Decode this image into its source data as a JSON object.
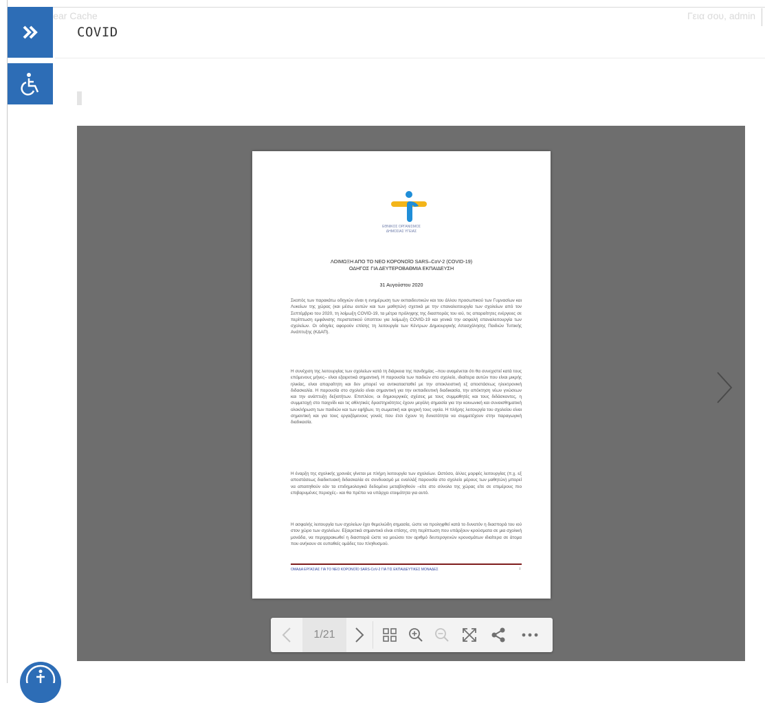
{
  "adminbar": {
    "clear_cache_label": "Clear Cache",
    "greeting": "Γεια σου, admin"
  },
  "sidebar": {
    "expand_icon": "double-chevron-right-icon",
    "accessibility_icon": "wheelchair-icon",
    "accent_color": "#2d6db6"
  },
  "page": {
    "title": "COVID"
  },
  "viewer": {
    "current_page": "1/21",
    "background_color": "#6e6e6e",
    "toolbar_icons": [
      "prev-page-icon",
      "next-page-icon",
      "grid-view-icon",
      "zoom-in-icon",
      "zoom-out-icon",
      "fullscreen-icon",
      "share-icon",
      "more-icon"
    ],
    "document": {
      "logo_text_line1": "ΕΘΝΙΚΟΣ ΟΡΓΑΝΙΣΜΟΣ",
      "logo_text_line2": "ΔΗΜΟΣΙΑΣ ΥΓΕΙΑΣ",
      "title_line1": "ΛΟΙΜΩΞΗ ΑΠΟ ΤΟ ΝΕΟ ΚΟΡΟΝΟΪΟ SARS–CoV-2 (COVID-19)",
      "title_line2": "ΟΔΗΓΟΣ ΓΙΑ ΔΕΥΤΕΡΟΒΑΘΜΙΑ ΕΚΠΑΙΔΕΥΣΗ",
      "date": "31 Αυγούστου 2020",
      "para1": "Σκοπός των παρακάτω οδηγιών είναι η ενημέρωση των εκπαιδευτικών και του άλλου προσωπικού των Γυμνασίων και Λυκείων της χώρας (και μέσω αυτών και των μαθητών) σχετικά με την επαναλειτουργία των σχολείων από τον Σεπτέμβριο του 2020, τη λοίμωξη COVID-19, τα μέτρα πρόληψης της διασποράς του ιού, τις απαραίτητες ενέργειες σε περίπτωση εμφάνισης περιστατικού ύποπτου για λοίμωξη COVID-19 και γενικά την ασφαλή επαναλειτουργία των σχολείων. Οι οδηγίες αφορούν επίσης τη λειτουργία των Κέντρων Δημιουργικής Απασχόλησης Παιδιών Τυπικής Ανάπτυξης (ΚΔΑΠ).",
      "para2": "Η συνέχιση της λειτουργίας των σχολείων κατά τη διάρκεια της πανδημίας –που αναμένεται ότι θα συνεχιστεί κατά τους επόμενους μήνες– είναι εξαιρετικά σημαντική. Η παρουσία των παιδιών στο σχολείο, ιδιαίτερα αυτών που είναι μικρής ηλικίας, είναι απαραίτητη και δεν μπορεί να αντικατασταθεί με την αποκλειστική εξ αποστάσεως ηλεκτρονική διδασκαλία. Η παρουσία στο σχολείο είναι σημαντική για την εκπαιδευτική διαδικασία, την απόκτηση νέων γνώσεων και την ανάπτυξη δεξιοτήτων. Επιπλέον, οι δημιουργικές σχέσεις με τους συμμαθητές και τους διδάσκοντες, η συμμετοχή στο παιχνίδι και τις αθλητικές δραστηριότητες έχουν μεγάλη σημασία για την κοινωνική και συναισθηματική ολοκλήρωση των παιδιών και των εφήβων, τη σωματική και ψυχική τους υγεία. Η πλήρης λειτουργία του σχολείου είναι σημαντική και για τους εργαζόμενους γονείς που έτσι έχουν τη δυνατότητα να συμμετέχουν στην παραγωγική διαδικασία.",
      "para3": "Η έναρξη της σχολικής χρονιάς γίνεται με πλήρη λειτουργία των σχολείων. Ωστόσο, άλλες μορφές λειτουργίας (π.χ. εξ αποστάσεως διαδικτυακή διδασκαλία σε συνδυασμό με εναλλάξ παρουσία στο σχολείο μέρους των μαθητών) μπορεί να απαιτηθούν εάν τα επιδημιολογικά δεδομένα μεταβληθούν –είτε στο σύνολο της χώρας είτε σε επιμέρους πιο επιβαρυμένες περιοχές– και θα πρέπει να υπάρχει ετοιμότητα για αυτό.",
      "para4": "Η ασφαλής λειτουργία των σχολείων έχει θεμελιώδη σημασία, ώστε να προληφθεί κατά το δυνατόν η διασπορά του ιού στον χώρο των σχολείων. Εξαιρετικά σημαντικό είναι επίσης, στη περίπτωση που υπάρξουν κρούσματα σε μια σχολική μονάδα, να περιχαρακωθεί η διασπορά ώστε να μειώσει τον αριθμό δευτερογενών κρουσμάτων ιδιαίτερα σε άτομα που ανήκουν σε ευπαθείς ομάδες του πληθυσμού.",
      "footer": "ΟΜΑΔΑ ΕΡΓΑΣΙΑΣ ΓΙΑ ΤΟ ΝΕΟ ΚΟΡΟΝΟΪΟ SARS-CoV-2 ΓΙΑ ΤΙΣ ΕΚΠΑΙΔΕΥΤΙΚΕΣ ΜΟΝΑΔΕΣ",
      "page_number": "1"
    }
  }
}
